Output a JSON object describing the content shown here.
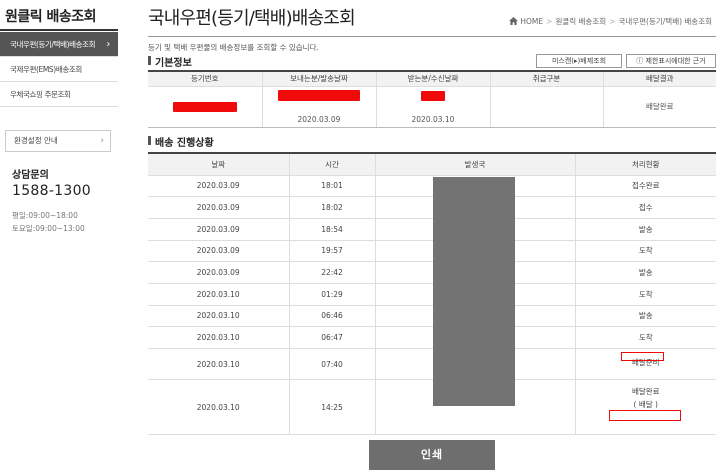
{
  "sidebar": {
    "title": "원클릭 배송조회",
    "items": [
      {
        "label": "국내우편(등기/택배)배송조회",
        "active": true
      },
      {
        "label": "국제우편(EMS)배송조회",
        "active": false
      },
      {
        "label": "우체국쇼핑 주문조회",
        "active": false
      }
    ],
    "env_settings": "환경설정 안내",
    "cs_title": "상담문의",
    "cs_phone": "1588-1300",
    "hours_weekday": "평일:09:00~18:00",
    "hours_saturday": "토요일:09:00~13:00",
    "chevron": "›"
  },
  "header": {
    "title": "국내우편(등기/택배)배송조회",
    "breadcrumb": [
      "HOME",
      "원클릭 배송조회",
      "국내우편(등기/택배) 배송조회"
    ],
    "description": "등기 및 택배 우편물의 배송정보를 조회할 수 있습니다."
  },
  "basic_info": {
    "section_title": "기본정보",
    "btn_unregistered": "미스캔(▸)배제조회",
    "btn_ack": "ⓘ 제한표시에대한 근거",
    "columns": [
      "등기번호",
      "보내는분/발송날짜",
      "받는분/수신날짜",
      "취급구분",
      "배달결과"
    ],
    "row": {
      "tracking_no": "",
      "sender_date": "2020.03.09",
      "receiver_date": "2020.03.10",
      "handling": "",
      "result": "배달완료"
    }
  },
  "progress": {
    "section_title": "배송 진행상황",
    "columns": [
      "날짜",
      "시간",
      "발생국",
      "처리현황"
    ],
    "rows": [
      {
        "date": "2020.03.09",
        "time": "18:01",
        "status": "접수완료"
      },
      {
        "date": "2020.03.09",
        "time": "18:02",
        "status": "접수"
      },
      {
        "date": "2020.03.09",
        "time": "18:54",
        "status": "발송"
      },
      {
        "date": "2020.03.09",
        "time": "19:57",
        "status": "도착"
      },
      {
        "date": "2020.03.09",
        "time": "22:42",
        "status": "발송"
      },
      {
        "date": "2020.03.10",
        "time": "01:29",
        "status": "도착"
      },
      {
        "date": "2020.03.10",
        "time": "06:46",
        "status": "발송"
      },
      {
        "date": "2020.03.10",
        "time": "06:47",
        "status": "도착"
      },
      {
        "date": "2020.03.10",
        "time": "07:40",
        "status": "배달준비"
      },
      {
        "date": "2020.03.10",
        "time": "14:25",
        "status": "배달완료",
        "status_sub": "( 배달 )"
      }
    ]
  },
  "print_button": "인쇄",
  "colors": {
    "redaction": "#f00a0a",
    "active_menu_bg": "#555555",
    "print_button_bg": "#6e6e6e",
    "gray_block": "#737373"
  }
}
